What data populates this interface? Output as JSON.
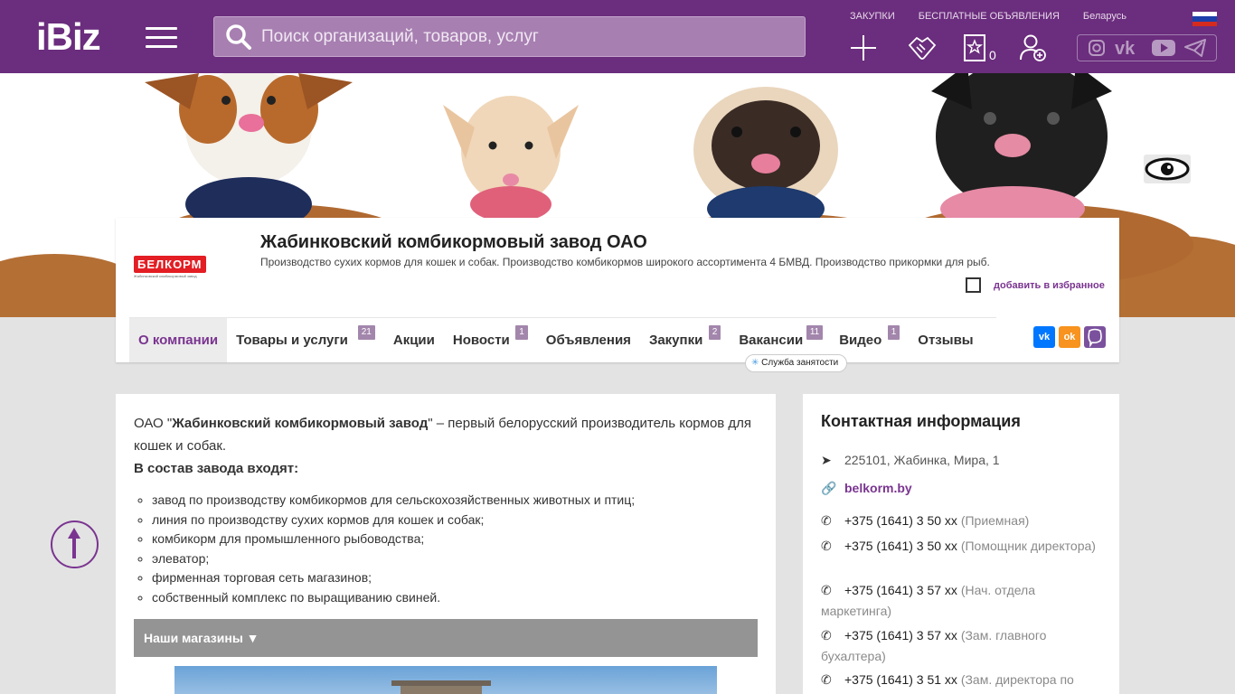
{
  "header": {
    "logo": "iBiz",
    "search_placeholder": "Поиск организаций, товаров, услуг",
    "links": [
      "ЗАКУПКИ",
      "БЕСПЛАТНЫЕ ОБЪЯВЛЕНИЯ",
      "Беларусь"
    ],
    "favorites_count": "0"
  },
  "company": {
    "logo_text": "БЕЛКОРМ",
    "logo_sub": "Жабинковский комбикормовый завод",
    "title": "Жабинковский комбикормовый завод ОАО",
    "description": "Производство сухих кормов для кошек и собак. Производство комбикормов широкого ассортимента 4 БМВД. Производство прикормки для рыб.",
    "favorite_label": "добавить в избранное"
  },
  "tabs": [
    {
      "label": "О компании",
      "badge": ""
    },
    {
      "label": "Товары и услуги",
      "badge": "21"
    },
    {
      "label": "Акции",
      "badge": ""
    },
    {
      "label": "Новости",
      "badge": "1"
    },
    {
      "label": "Объявления",
      "badge": ""
    },
    {
      "label": "Закупки",
      "badge": "2"
    },
    {
      "label": "Вакансии",
      "badge": "11"
    },
    {
      "label": "Видео",
      "badge": "1"
    },
    {
      "label": "Отзывы",
      "badge": ""
    }
  ],
  "employment_badge": "Служба занятости",
  "about": {
    "intro_prefix": "ОАО \"",
    "intro_bold": "Жабинковский комбикормовый завод",
    "intro_suffix": "\" – первый белорусский производитель кормов для кошек и собак.",
    "list_heading": "В состав завода входят:",
    "items": [
      "завод по производству комбикормов для сельскохозяйственных животных и птиц;",
      "линия по производству сухих кормов для кошек и собак;",
      "комбикорм для промышленного рыбоводства;",
      "элеватор;",
      "фирменная торговая сеть  магазинов;",
      "собственный комплекс по выращиванию свиней."
    ],
    "shops_label": "Наши магазины ▼"
  },
  "contact": {
    "title": "Контактная информация",
    "address": "225101, Жабинка, Мира, 1",
    "website": "belkorm.by",
    "phones": [
      {
        "number": "+375 (1641) 3 50 xx",
        "note": "(Приемная)"
      },
      {
        "number": "+375 (1641) 3 50 xx",
        "note": "(Помощник директора)"
      },
      {
        "number": "+375 (1641) 3 57 xx",
        "note": "(Нач. отдела маркетинга)"
      },
      {
        "number": "+375 (1641) 3 57 xx",
        "note": "(Зам. главного бухалтера)"
      },
      {
        "number": "+375 (1641) 3 51 xx",
        "note": "(Зам. директора по"
      }
    ]
  },
  "colors": {
    "brand": "#6b2d7d",
    "accent": "#7a3490",
    "badge": "#a386ac"
  }
}
